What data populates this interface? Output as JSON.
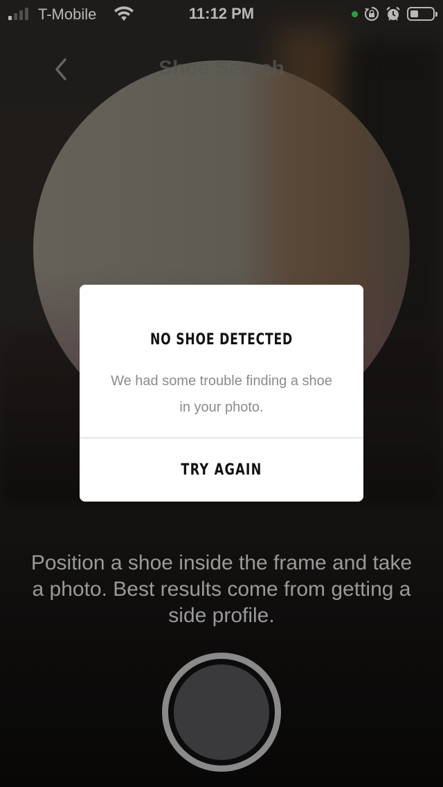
{
  "status_bar": {
    "carrier": "T-Mobile",
    "time": "11:12 PM",
    "icons": [
      "signal-icon",
      "wifi-icon",
      "camera-in-use-dot",
      "orientation-lock-icon",
      "alarm-icon",
      "battery-icon"
    ]
  },
  "nav": {
    "title": "Shoe Search",
    "back_icon": "chevron-left-icon"
  },
  "dialog": {
    "title": "NO SHOE DETECTED",
    "message": "We had some trouble finding a shoe in your photo.",
    "action_label": "TRY AGAIN"
  },
  "instructions": "Position a shoe inside the frame and take a photo. Best results come from getting a side profile.",
  "colors": {
    "dialog_bg": "#ffffff",
    "dialog_title": "#111111",
    "dialog_message": "#8a8a8a",
    "instruction_text": "#9a9a9a",
    "shutter_ring": "#8a8a8a",
    "shutter_fill": "#3a393b",
    "camera_active_dot": "#3ddc5a"
  }
}
